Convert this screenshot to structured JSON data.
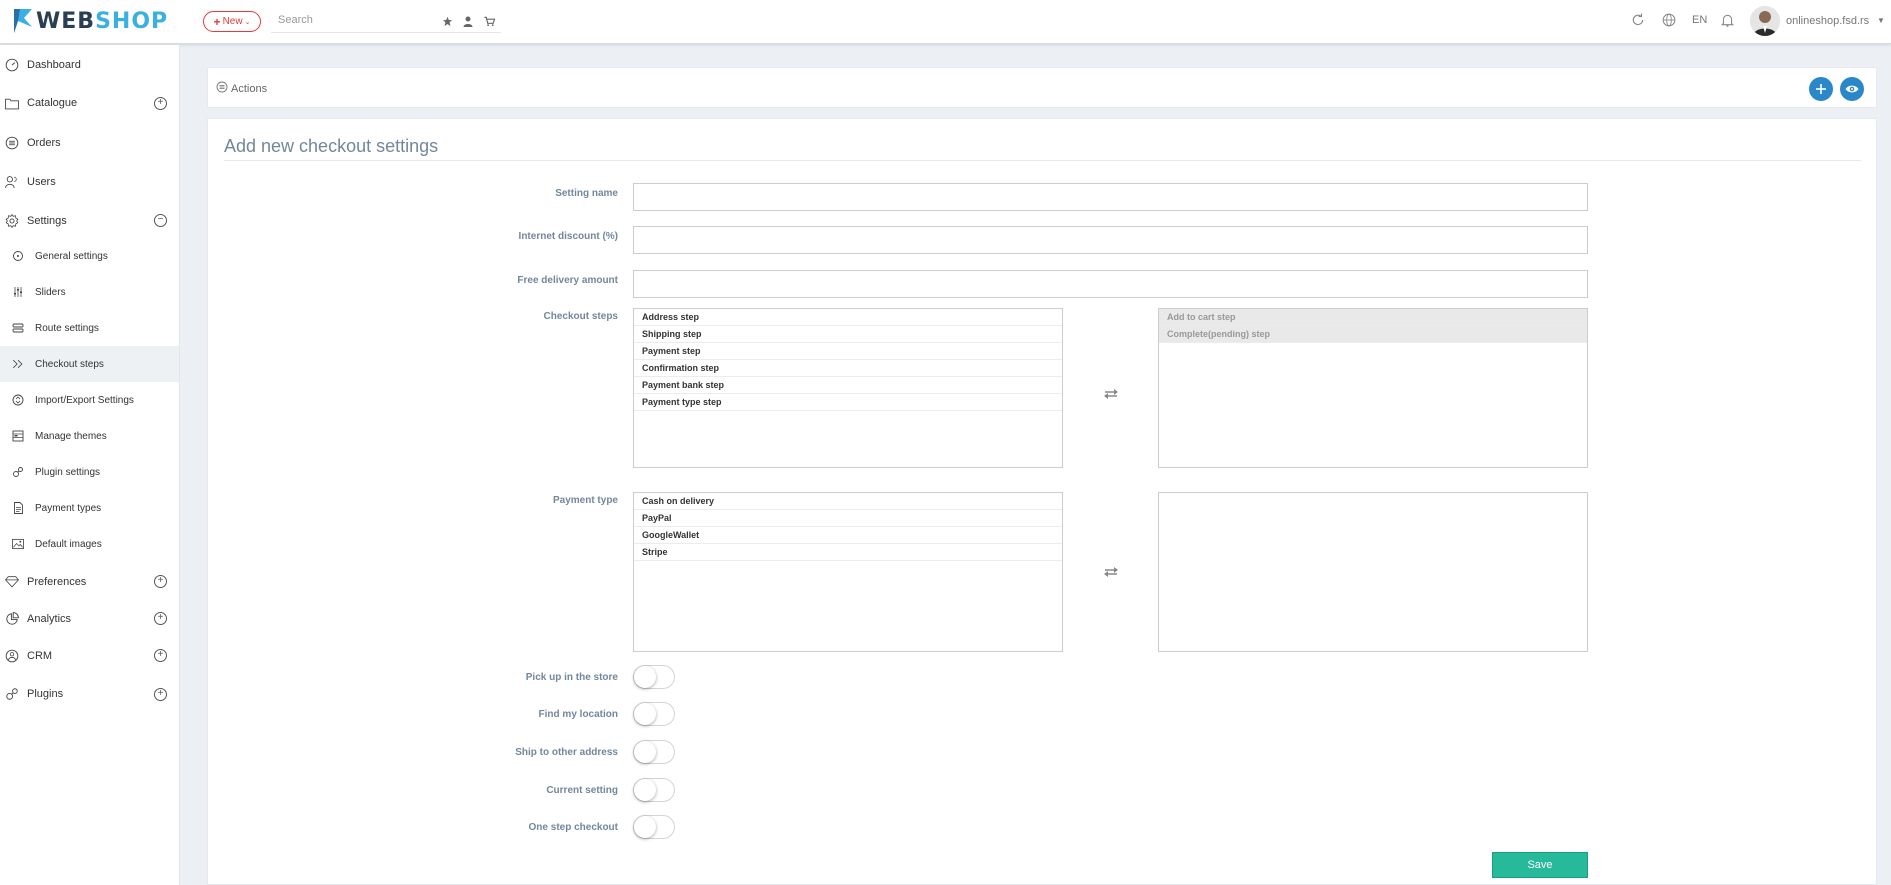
{
  "brand": {
    "part1": "WEB",
    "part2": "SHOP"
  },
  "topbar": {
    "new_label": "New",
    "search_placeholder": "Search",
    "language": "EN",
    "user": "onlineshop.fsd.rs"
  },
  "sidebar": {
    "dashboard": "Dashboard",
    "catalogue": "Catalogue",
    "orders": "Orders",
    "users": "Users",
    "settings": "Settings",
    "sub": {
      "general": "General settings",
      "sliders": "Sliders",
      "route": "Route settings",
      "checkout": "Checkout steps",
      "import_export": "Import/Export Settings",
      "themes": "Manage themes",
      "plugin": "Plugin settings",
      "payment_types": "Payment types",
      "default_images": "Default images"
    },
    "preferences": "Preferences",
    "analytics": "Analytics",
    "crm": "CRM",
    "plugins": "Plugins"
  },
  "actions": {
    "label": "Actions"
  },
  "form": {
    "title": "Add new checkout settings",
    "setting_name_label": "Setting name",
    "setting_name_value": "",
    "internet_discount_label": "Internet discount (%)",
    "internet_discount_value": "",
    "free_delivery_label": "Free delivery amount",
    "free_delivery_value": "",
    "checkout_steps_label": "Checkout steps",
    "checkout_steps_available": [
      "Address step",
      "Shipping step",
      "Payment step",
      "Confirmation step",
      "Payment bank step",
      "Payment type step"
    ],
    "checkout_steps_selected": [
      "Add to cart step",
      "Complete(pending) step"
    ],
    "payment_type_label": "Payment type",
    "payment_types_available": [
      "Cash on delivery",
      "PayPal",
      "GoogleWallet",
      "Stripe"
    ],
    "payment_types_selected": [],
    "toggles": {
      "pickup": "Pick up in the store",
      "find_location": "Find my location",
      "ship_other": "Ship to other address",
      "current": "Current setting",
      "one_step": "One step checkout"
    },
    "save_label": "Save"
  }
}
